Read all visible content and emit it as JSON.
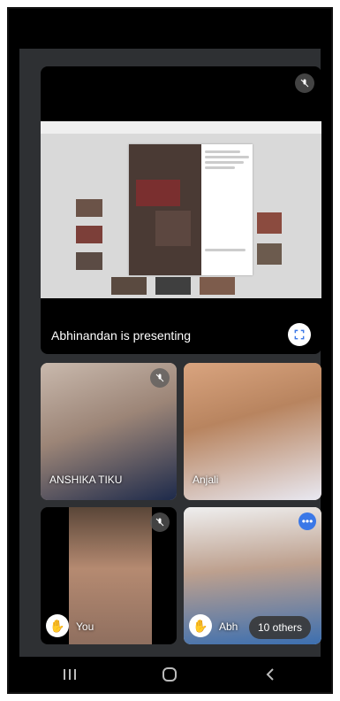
{
  "presentation": {
    "presenter_label": "Abhinandan is presenting",
    "mic_muted": true
  },
  "participants": [
    {
      "name": "ANSHIKA TIKU",
      "mic_muted": true
    },
    {
      "name": "Anjali",
      "mic_muted": false
    },
    {
      "name": "You",
      "mic_muted": true,
      "raise_hand": true
    },
    {
      "name": "Abh",
      "raise_hand": true,
      "others_badge": "10 others"
    }
  ],
  "icons": {
    "mute": "mic-off-icon",
    "fullscreen": "fullscreen-icon",
    "raise_hand": "hand-icon",
    "more": "more-options-icon",
    "nav_recents": "recents-icon",
    "nav_home": "home-icon",
    "nav_back": "back-icon"
  },
  "colors": {
    "background": "#2e3033",
    "accent": "#3b78e7"
  }
}
